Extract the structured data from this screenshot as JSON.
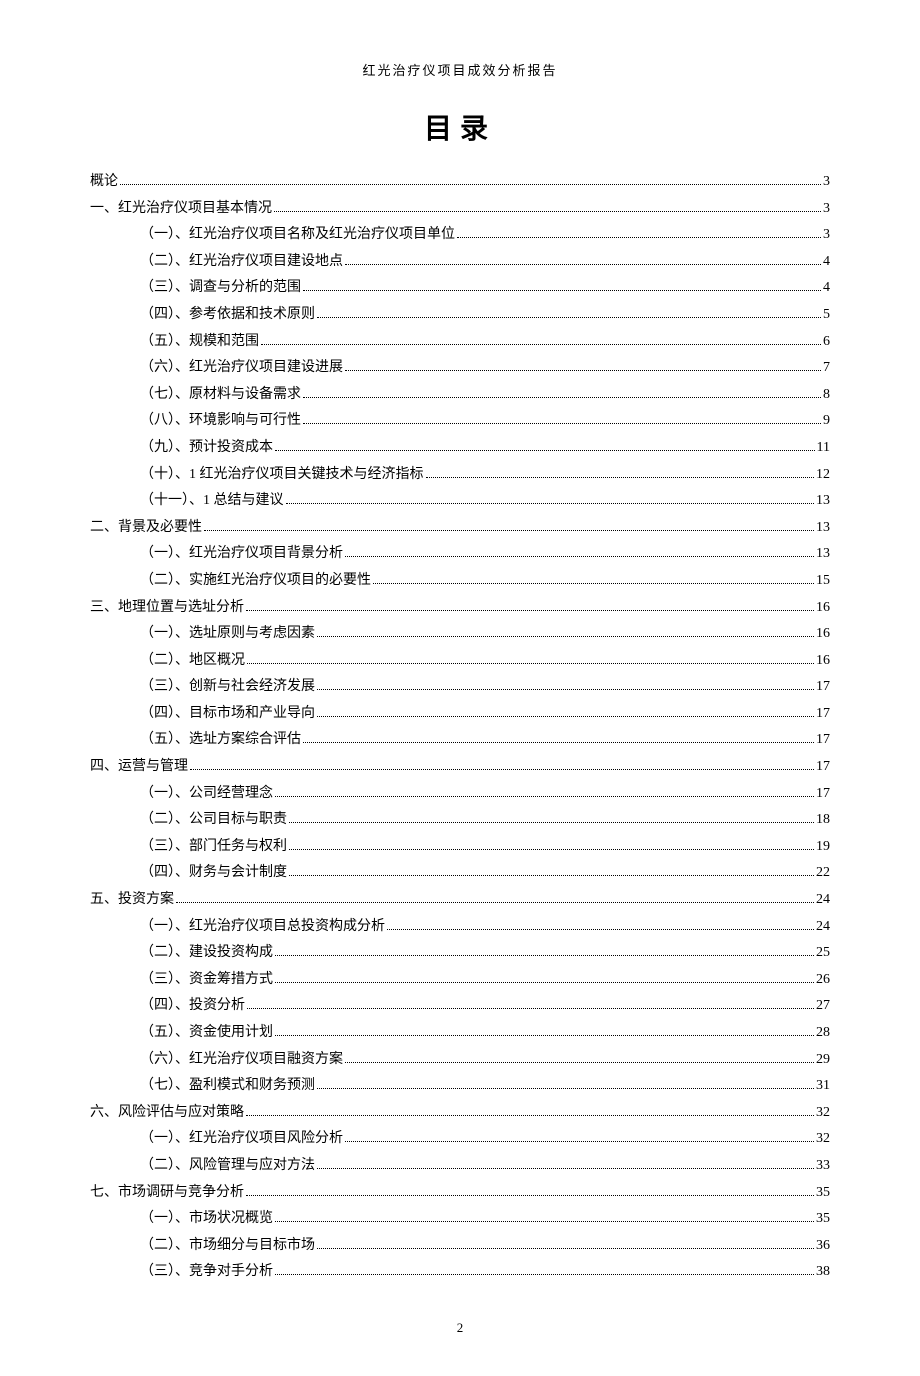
{
  "header": "红光治疗仪项目成效分析报告",
  "title": "目录",
  "page_number": "2",
  "toc": [
    {
      "level": 1,
      "label": "概论",
      "page": "3"
    },
    {
      "level": 1,
      "label": "一、红光治疗仪项目基本情况",
      "page": "3"
    },
    {
      "level": 2,
      "label": "（一）、红光治疗仪项目名称及红光治疗仪项目单位",
      "page": "3"
    },
    {
      "level": 2,
      "label": "（二）、红光治疗仪项目建设地点",
      "page": "4"
    },
    {
      "level": 2,
      "label": "（三）、调查与分析的范围",
      "page": "4"
    },
    {
      "level": 2,
      "label": "（四）、参考依据和技术原则",
      "page": "5"
    },
    {
      "level": 2,
      "label": "（五）、规模和范围",
      "page": "6"
    },
    {
      "level": 2,
      "label": "（六）、红光治疗仪项目建设进展",
      "page": "7"
    },
    {
      "level": 2,
      "label": "（七）、原材料与设备需求",
      "page": "8"
    },
    {
      "level": 2,
      "label": "（八）、环境影响与可行性",
      "page": "9"
    },
    {
      "level": 2,
      "label": "（九）、预计投资成本",
      "page": "11"
    },
    {
      "level": 2,
      "label": "（十）、1 红光治疗仪项目关键技术与经济指标",
      "page": "12"
    },
    {
      "level": 2,
      "label": "（十一）、1 总结与建议",
      "page": "13"
    },
    {
      "level": 1,
      "label": "二、背景及必要性",
      "page": "13"
    },
    {
      "level": 2,
      "label": "（一）、红光治疗仪项目背景分析",
      "page": "13"
    },
    {
      "level": 2,
      "label": "（二）、实施红光治疗仪项目的必要性",
      "page": "15"
    },
    {
      "level": 1,
      "label": "三、地理位置与选址分析",
      "page": "16"
    },
    {
      "level": 2,
      "label": "（一）、选址原则与考虑因素",
      "page": "16"
    },
    {
      "level": 2,
      "label": "（二）、地区概况",
      "page": "16"
    },
    {
      "level": 2,
      "label": "（三）、创新与社会经济发展",
      "page": "17"
    },
    {
      "level": 2,
      "label": "（四）、目标市场和产业导向",
      "page": "17"
    },
    {
      "level": 2,
      "label": "（五）、选址方案综合评估",
      "page": "17"
    },
    {
      "level": 1,
      "label": "四、运营与管理",
      "page": "17"
    },
    {
      "level": 2,
      "label": "（一）、公司经营理念",
      "page": "17"
    },
    {
      "level": 2,
      "label": "（二）、公司目标与职责",
      "page": "18"
    },
    {
      "level": 2,
      "label": "（三）、部门任务与权利",
      "page": "19"
    },
    {
      "level": 2,
      "label": "（四）、财务与会计制度",
      "page": "22"
    },
    {
      "level": 1,
      "label": "五、投资方案",
      "page": "24"
    },
    {
      "level": 2,
      "label": "（一）、红光治疗仪项目总投资构成分析",
      "page": "24"
    },
    {
      "level": 2,
      "label": "（二）、建设投资构成",
      "page": "25"
    },
    {
      "level": 2,
      "label": "（三）、资金筹措方式",
      "page": "26"
    },
    {
      "level": 2,
      "label": "（四）、投资分析",
      "page": "27"
    },
    {
      "level": 2,
      "label": "（五）、资金使用计划",
      "page": "28"
    },
    {
      "level": 2,
      "label": "（六）、红光治疗仪项目融资方案",
      "page": "29"
    },
    {
      "level": 2,
      "label": "（七）、盈利模式和财务预测",
      "page": "31"
    },
    {
      "level": 1,
      "label": "六、风险评估与应对策略",
      "page": "32"
    },
    {
      "level": 2,
      "label": "（一）、红光治疗仪项目风险分析",
      "page": "32"
    },
    {
      "level": 2,
      "label": "（二）、风险管理与应对方法",
      "page": "33"
    },
    {
      "level": 1,
      "label": "七、市场调研与竞争分析",
      "page": "35"
    },
    {
      "level": 2,
      "label": "（一）、市场状况概览",
      "page": "35"
    },
    {
      "level": 2,
      "label": "（二）、市场细分与目标市场",
      "page": "36"
    },
    {
      "level": 2,
      "label": "（三）、竞争对手分析",
      "page": "38"
    }
  ]
}
